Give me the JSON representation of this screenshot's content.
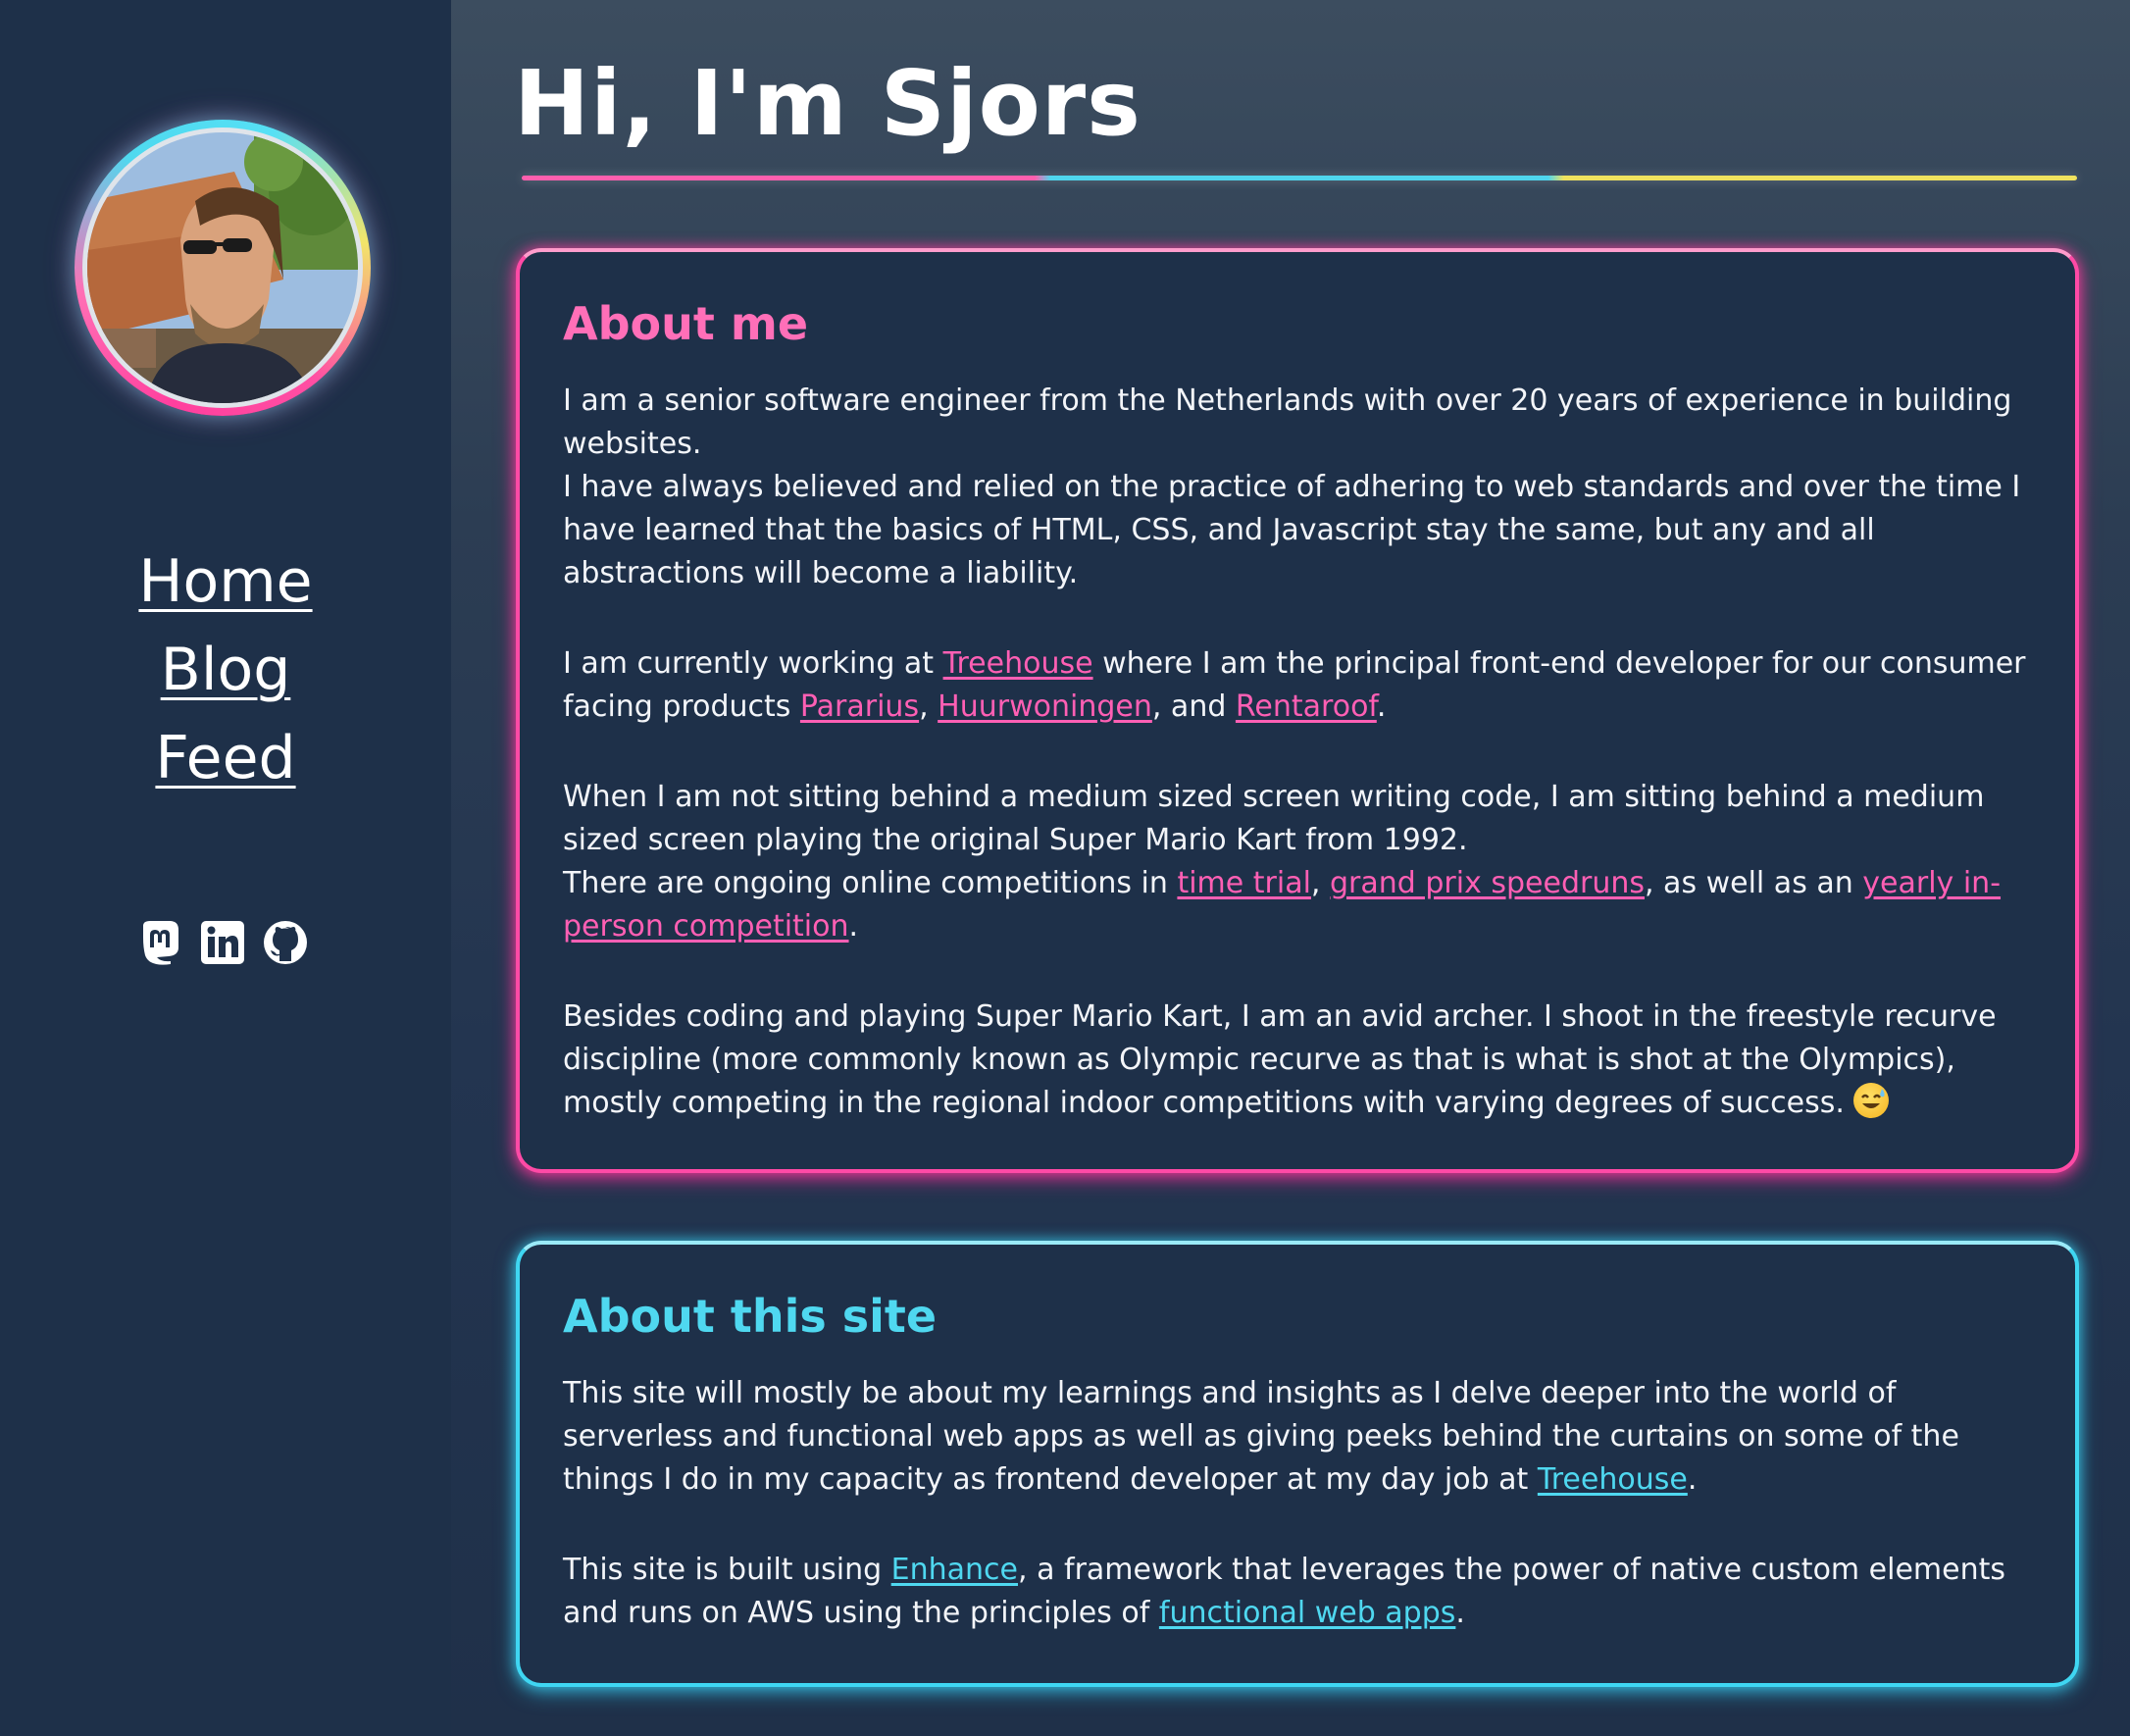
{
  "sidebar": {
    "nav": [
      {
        "label": "Home"
      },
      {
        "label": "Blog"
      },
      {
        "label": "Feed"
      }
    ],
    "socials": [
      "mastodon-icon",
      "linkedin-icon",
      "github-icon"
    ]
  },
  "header": {
    "title": "Hi, I'm Sjors"
  },
  "about_me": {
    "heading": "About me",
    "p1a": "I am a senior software engineer from the Netherlands with over 20 years of experience in building websites.",
    "p1b": "I have always believed and relied on the practice of adhering to web standards and over the time I have learned that the basics of HTML, CSS, and Javascript stay the same, but any and all abstractions will become a liability.",
    "p2_start": "I am currently working at ",
    "p2_link_treehouse": "Treehouse",
    "p2_mid": " where I am the principal front-end developer for our consumer facing products ",
    "p2_link_pararius": "Pararius",
    "p2_sep1": ", ",
    "p2_link_huurwoningen": "Huurwoningen",
    "p2_sep2": ", and ",
    "p2_link_rentaroof": "Rentaroof",
    "p2_end": ".",
    "p3a": "When I am not sitting behind a medium sized screen writing code, I am sitting behind a medium sized screen playing the original Super Mario Kart from 1992.",
    "p3b_start": "There are ongoing online competitions in ",
    "p3_link_timetrial": "time trial",
    "p3_sep1": ", ",
    "p3_link_gp": "grand prix speedruns",
    "p3_mid": ", as well as an ",
    "p3_link_yearly": "yearly in-person competition",
    "p3_end": ".",
    "p4": "Besides coding and playing Super Mario Kart, I am an avid archer. I shoot in the freestyle recurve discipline (more commonly known as Olympic recurve as that is what is shot at the Olympics), mostly competing in the regional indoor competitions with varying degrees of success. "
  },
  "about_site": {
    "heading": "About this site",
    "p1_start": "This site will mostly be about my learnings and insights as I delve deeper into the world of serverless and functional web apps as well as giving peeks behind the curtains on some of the things I do in my capacity as frontend developer at my day job at ",
    "p1_link_treehouse": "Treehouse",
    "p1_end": ".",
    "p2_start": "This site is built using ",
    "p2_link_enhance": "Enhance",
    "p2_mid": ", a framework that leverages the power of native custom elements and runs on AWS using the principles of ",
    "p2_link_fwa": "functional web apps",
    "p2_end": "."
  },
  "colors": {
    "pink": "#ff4aa6",
    "cyan": "#3fd6f2",
    "yellow": "#f0e25e",
    "background": "#1e3049"
  }
}
